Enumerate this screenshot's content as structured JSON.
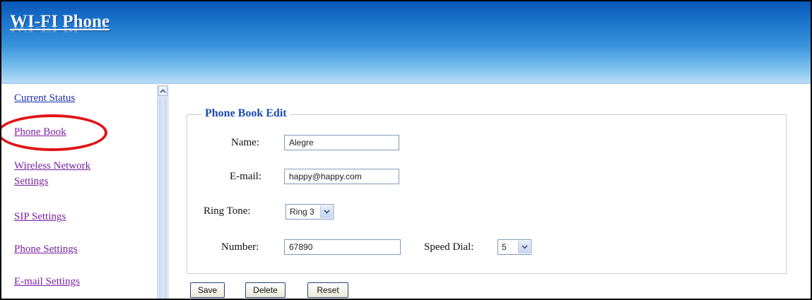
{
  "header": {
    "logo": "WI-FI Phone"
  },
  "sidebar": {
    "items": [
      {
        "label": "Current Status"
      },
      {
        "label": "Phone Book"
      },
      {
        "label": "Wireless Network"
      },
      {
        "label": "Settings"
      },
      {
        "label": "SIP Settings"
      },
      {
        "label": "Phone Settings"
      },
      {
        "label": "E-mail Settings"
      }
    ]
  },
  "form": {
    "legend": "Phone Book Edit",
    "name_label": "Name:",
    "name_value": "Alegre",
    "email_label": "E-mail:",
    "email_value": "happy@happy.com",
    "ringtone_label": "Ring Tone:",
    "ringtone_value": "Ring 3",
    "number_label": "Number:",
    "number_value": "67890",
    "speed_dial_label": "Speed Dial:",
    "speed_dial_value": "5"
  },
  "buttons": {
    "save": "Save",
    "delete": "Delete",
    "reset": "Reset"
  },
  "colors": {
    "link_visited": "#7a1fa0",
    "link": "#1a2ea8",
    "legend": "#1a49b0",
    "highlight_ring": "#e01414",
    "header_top": "#0a57b8",
    "header_bottom": "#b6dcf6"
  }
}
